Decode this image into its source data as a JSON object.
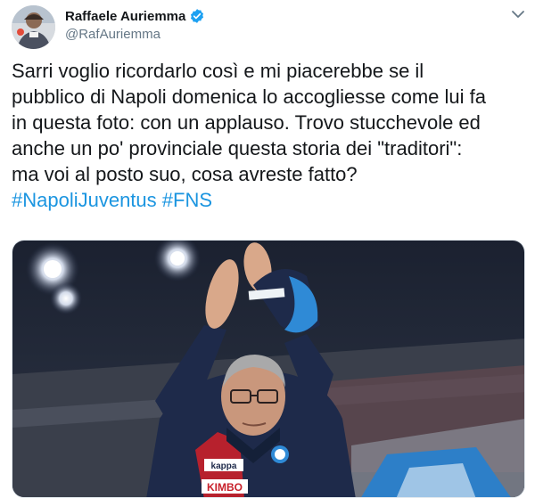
{
  "author": {
    "display_name": "Raffaele Auriemma",
    "handle": "@RafAuriemma",
    "verified": true
  },
  "tweet": {
    "lines": [
      "Sarri voglio ricordarlo così e mi piacerebbe se il",
      "pubblico di Napoli domenica lo accogliesse come lui fa",
      "in questa foto: con un applauso. Trovo stucchevole ed",
      "anche un po' provinciale questa storia dei \"traditori\":",
      "ma voi al posto suo, cosa avreste fatto?"
    ],
    "hashtags": [
      "#NapoliJuventus",
      "#FNS"
    ]
  },
  "photo": {
    "jersey_sponsor": "KIMBO",
    "jersey_brand": "kappa"
  },
  "colors": {
    "link": "#1b95e0",
    "verified": "#1da1f2",
    "secondary_text": "#657786"
  },
  "icons": {
    "verified": "verified-badge-icon",
    "menu": "chevron-down-icon"
  }
}
